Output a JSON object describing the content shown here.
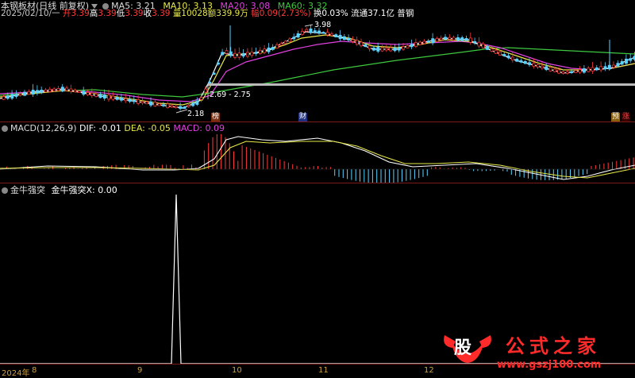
{
  "header": {
    "title": "本钢板材(日线 前复权)",
    "ma5": "MA5: 3.21",
    "ma10": "MA10: 3.13",
    "ma20": "MA20: 3.08",
    "ma60": "MA60: 3.32"
  },
  "quote": {
    "date": "2025/02/10/一",
    "open_label": "开",
    "open": "3.39",
    "high_label": "高",
    "high": "3.39",
    "low_label": "低",
    "low": "3.39",
    "close_label": "收",
    "close": "3.39",
    "volume": "量10028",
    "amount": "额339.9万",
    "change": "幅0.09(2.73%)",
    "turnover": "换0.03%",
    "float": "流通37.1亿",
    "category": "普钢"
  },
  "price_annotations": {
    "high_mark": "3.98",
    "low_mark": "2.18",
    "range_label": "2.69 - 2.75"
  },
  "event_tags": [
    "榜",
    "财",
    "预",
    "涨"
  ],
  "macd": {
    "title": "MACD(12,26,9)",
    "dif": "DIF: -0.01",
    "dea": "DEA: -0.05",
    "macd": "MACD: 0.09"
  },
  "indicator": {
    "title": "金牛强突",
    "value": "金牛强突X: 0.00"
  },
  "x_axis": [
    "2024年",
    "8",
    "9",
    "10",
    "11",
    "12"
  ],
  "watermark": {
    "logo_text": "股",
    "brand": "公式之家",
    "url": "www.gszj100.com"
  },
  "colors": {
    "up": "#ff3a3a",
    "down": "#5ad2ff",
    "ma5": "#ffffff",
    "ma10": "#e8e84a",
    "ma20": "#e040e0",
    "ma60": "#3ec83e",
    "separator": "#7a1a1a"
  }
}
